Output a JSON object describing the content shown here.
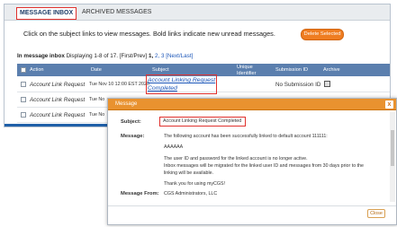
{
  "tabs": {
    "inbox": "MESSAGE INBOX",
    "archived": "ARCHIVED MESSAGES"
  },
  "instructions": "Click on the subject links to view messages. Bold links indicate new unread messages.",
  "delete_button": "Delete Selected",
  "pager": {
    "label": "In message inbox",
    "range": "Displaying 1-8 of 17.",
    "first_prev": "[First/Prev]",
    "page1": "1,",
    "page2": "2,",
    "page3": "3",
    "next_last": "[Next/Last]"
  },
  "columns": {
    "action": "Action",
    "date": "Date",
    "subject": "Subject",
    "unique_1": "Unique",
    "unique_2": "Identifier",
    "submission_id": "Submission ID",
    "archive": "Archive"
  },
  "rows": [
    {
      "action": "Account Link Request",
      "date": "Tue Nov 10 12:00 EST 2020",
      "subject": "Account Linking Request Completed",
      "submission_id": "No Submission ID"
    },
    {
      "action": "Account Link Request",
      "date": "Tue No"
    },
    {
      "action": "Account Link Request",
      "date": "Tue No"
    }
  ],
  "modal": {
    "title": "Message",
    "close_glyph": "x",
    "subject_label": "Subject:",
    "subject_value": "Account Linking Request Completed",
    "message_label": "Message:",
    "lines": [
      "The following account has been successfully linked to default account 111111:",
      "AAAAAA",
      "The user ID and password for the linked account is no longer active.",
      "Inbox messages will be migrated for the linked user ID and messages from 30 days prior to the",
      "linking will be available.",
      "Thank you for using myCGS!"
    ],
    "from_label": "Message From:",
    "from_value": "CGS Administrators, LLC",
    "close_button": "Close"
  },
  "colors": {
    "accent_orange": "#ef7d21",
    "header_blue": "#5b7fae",
    "highlight_red": "#e0312d",
    "link_blue": "#1a55b8"
  }
}
